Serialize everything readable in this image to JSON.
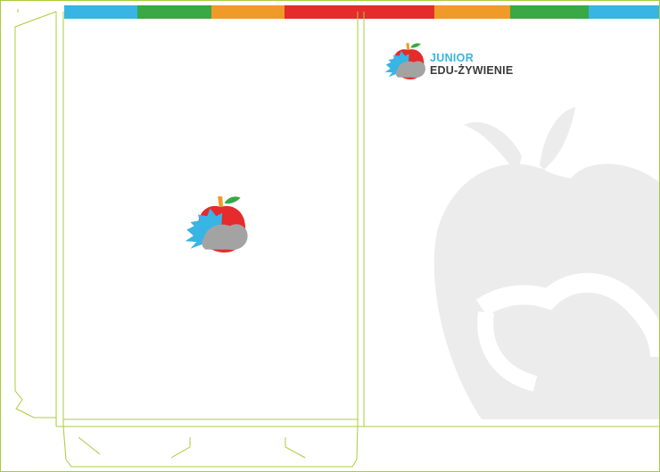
{
  "stripe_colors": [
    "#38b4e5",
    "#3aa844",
    "#f09a2a",
    "#e52b2b",
    "#f09a2a",
    "#3aa844",
    "#38b4e5"
  ],
  "brand": {
    "line1": "JUNIOR",
    "line2": "EDU-ŻYWIENIE",
    "line1_color": "#38b4e5",
    "line2_color": "#3a3a3a"
  },
  "logo_colors": {
    "apple": "#e52b2b",
    "leaf": "#3aa844",
    "stem": "#f09a2a",
    "hedgehog_spikes": "#38b4e5",
    "hedgehog_body": "#a3a3a3"
  },
  "dieline_color": "#a8cc3c",
  "watermark_color": "#ececec",
  "icons": [
    "brand-logo-icon",
    "center-logo-icon",
    "watermark-apple-icon"
  ]
}
